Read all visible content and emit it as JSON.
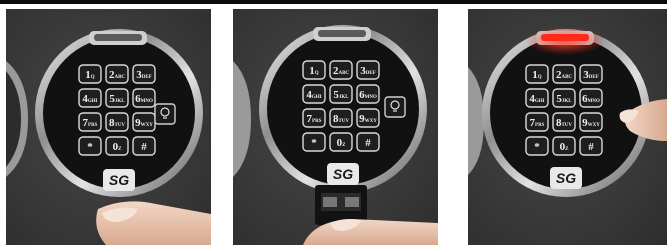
{
  "panels": [
    {
      "brand_logo": "SG",
      "keys": [
        {
          "main": "1",
          "sub": "Q"
        },
        {
          "main": "2",
          "sub": "ABC"
        },
        {
          "main": "3",
          "sub": "DEF"
        },
        {
          "main": "4",
          "sub": "GHI"
        },
        {
          "main": "5",
          "sub": "JKL"
        },
        {
          "main": "6",
          "sub": "MNO"
        },
        {
          "main": "7",
          "sub": "PRS"
        },
        {
          "main": "8",
          "sub": "TUV"
        },
        {
          "main": "9",
          "sub": "WXY"
        },
        {
          "main": "*",
          "sub": ""
        },
        {
          "main": "0",
          "sub": "Z"
        },
        {
          "main": "#",
          "sub": ""
        }
      ],
      "indicator_color": "#5a5a5a",
      "shows_light_icon": true,
      "shows_battery_drawer": false,
      "hand": "bottom"
    },
    {
      "brand_logo": "SG",
      "keys": [
        {
          "main": "1",
          "sub": "Q"
        },
        {
          "main": "2",
          "sub": "ABC"
        },
        {
          "main": "3",
          "sub": "DEF"
        },
        {
          "main": "4",
          "sub": "GHI"
        },
        {
          "main": "5",
          "sub": "JKL"
        },
        {
          "main": "6",
          "sub": "MNO"
        },
        {
          "main": "7",
          "sub": "PRS"
        },
        {
          "main": "8",
          "sub": "TUV"
        },
        {
          "main": "9",
          "sub": "WXY"
        },
        {
          "main": "*",
          "sub": ""
        },
        {
          "main": "0",
          "sub": "Z"
        },
        {
          "main": "#",
          "sub": ""
        }
      ],
      "indicator_color": "#5a5a5a",
      "shows_light_icon": true,
      "shows_battery_drawer": true,
      "hand": "bottom"
    },
    {
      "brand_logo": "SG",
      "keys": [
        {
          "main": "1",
          "sub": "Q"
        },
        {
          "main": "2",
          "sub": "ABC"
        },
        {
          "main": "3",
          "sub": "DEF"
        },
        {
          "main": "4",
          "sub": "GHI"
        },
        {
          "main": "5",
          "sub": "JKL"
        },
        {
          "main": "6",
          "sub": "MNO"
        },
        {
          "main": "7",
          "sub": "PRS"
        },
        {
          "main": "8",
          "sub": "TUV"
        },
        {
          "main": "9",
          "sub": "WXY"
        },
        {
          "main": "*",
          "sub": ""
        },
        {
          "main": "0",
          "sub": "Z"
        },
        {
          "main": "#",
          "sub": ""
        }
      ],
      "indicator_color": "#ff2a1a",
      "shows_light_icon": false,
      "shows_battery_drawer": false,
      "hand": "right"
    }
  ]
}
